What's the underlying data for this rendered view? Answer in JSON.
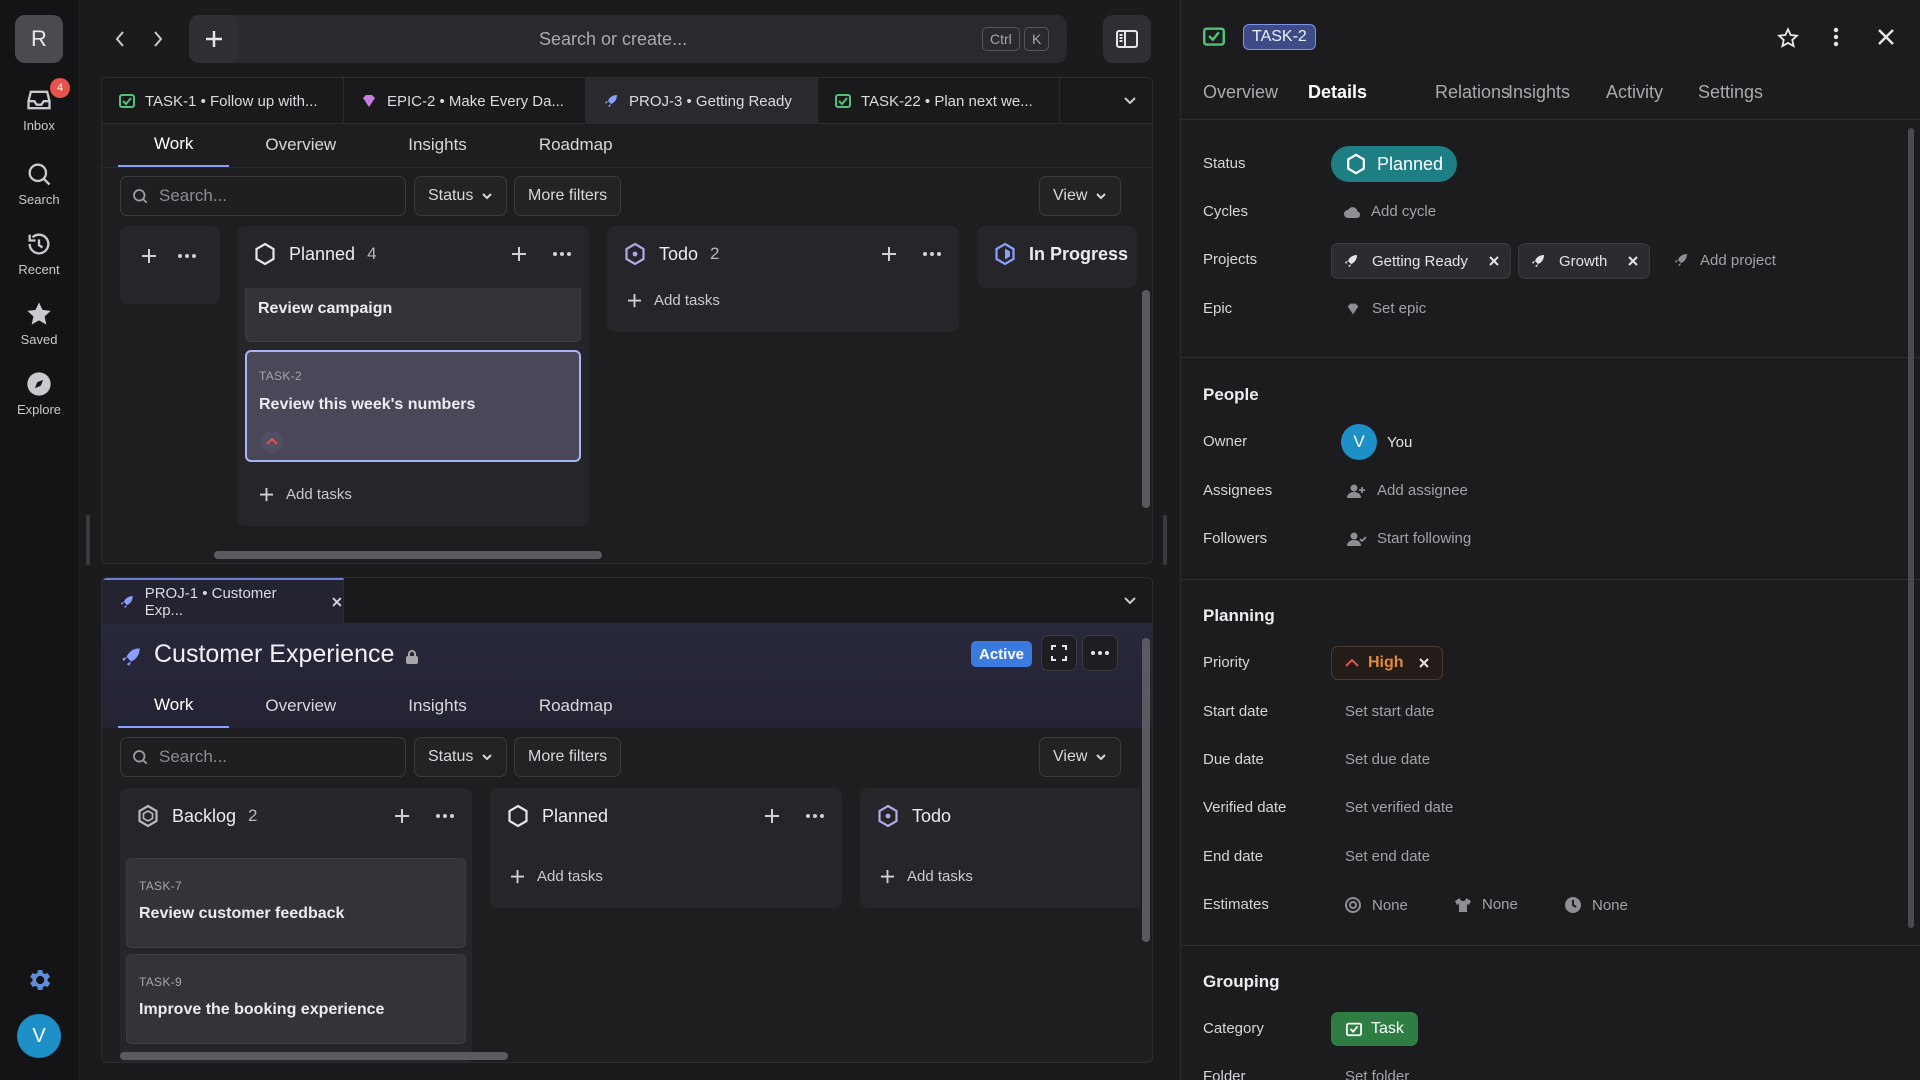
{
  "sidebar": {
    "workspace_initial": "R",
    "items": [
      {
        "label": "Inbox",
        "badge": "4"
      },
      {
        "label": "Search"
      },
      {
        "label": "Recent"
      },
      {
        "label": "Saved"
      },
      {
        "label": "Explore"
      }
    ],
    "user_initial": "V"
  },
  "topbar": {
    "search_placeholder": "Search or create...",
    "shortcut_keys": [
      "Ctrl",
      "K"
    ]
  },
  "upper_pane": {
    "tabs": [
      {
        "label": "TASK-1 • Follow up with...",
        "icon": "task-icon"
      },
      {
        "label": "EPIC-2 • Make Every Da...",
        "icon": "epic-icon"
      },
      {
        "label": "PROJ-3 • Getting Ready",
        "icon": "project-icon"
      },
      {
        "label": "TASK-22 • Plan next we...",
        "icon": "task-icon"
      }
    ],
    "subtabs": [
      "Work",
      "Overview",
      "Insights",
      "Roadmap"
    ],
    "filters": {
      "search_placeholder": "Search...",
      "status": "Status",
      "more": "More filters",
      "view": "View"
    },
    "columns": [
      {
        "title": "Planned",
        "count": "4",
        "cards": [
          {
            "title": "Review campaign"
          },
          {
            "id": "TASK-2",
            "title": "Review this week's numbers"
          }
        ],
        "add": "Add tasks"
      },
      {
        "title": "Todo",
        "count": "2",
        "add": "Add tasks"
      },
      {
        "title": "In Progress"
      }
    ]
  },
  "lower_pane": {
    "tab": "PROJ-1 • Customer Exp...",
    "project_title": "Customer Experience",
    "status_badge": "Active",
    "subtabs": [
      "Work",
      "Overview",
      "Insights",
      "Roadmap"
    ],
    "filters": {
      "search_placeholder": "Search...",
      "status": "Status",
      "more": "More filters",
      "view": "View"
    },
    "columns": [
      {
        "title": "Backlog",
        "count": "2",
        "cards": [
          {
            "id": "TASK-7",
            "title": "Review customer feedback"
          },
          {
            "id": "TASK-9",
            "title": "Improve the booking experience"
          }
        ]
      },
      {
        "title": "Planned",
        "add": "Add tasks"
      },
      {
        "title": "Todo",
        "add": "Add tasks"
      }
    ]
  },
  "detail": {
    "task_id": "TASK-2",
    "tabs": [
      "Overview",
      "Details",
      "Relations",
      "Insights",
      "Activity",
      "Settings"
    ],
    "status_label": "Status",
    "status_value": "Planned",
    "cycles_label": "Cycles",
    "cycles_value": "Add cycle",
    "projects_label": "Projects",
    "projects": [
      "Getting Ready",
      "Growth"
    ],
    "add_project": "Add project",
    "epic_label": "Epic",
    "epic_value": "Set epic",
    "people_title": "People",
    "owner_label": "Owner",
    "owner_initial": "V",
    "owner_value": "You",
    "assignees_label": "Assignees",
    "assignees_value": "Add assignee",
    "followers_label": "Followers",
    "followers_value": "Start following",
    "planning_title": "Planning",
    "priority_label": "Priority",
    "priority_value": "High",
    "start_label": "Start date",
    "start_value": "Set start date",
    "due_label": "Due date",
    "due_value": "Set due date",
    "verified_label": "Verified date",
    "verified_value": "Set verified date",
    "end_label": "End date",
    "end_value": "Set end date",
    "estimates_label": "Estimates",
    "estimates": [
      "None",
      "None",
      "None"
    ],
    "grouping_title": "Grouping",
    "category_label": "Category",
    "category_value": "Task",
    "folder_label": "Folder",
    "folder_value": "Set folder"
  },
  "colors": {
    "accent": "#8aa0ff",
    "status_planned": "#1d7f83",
    "category_task": "#2e7d43",
    "priority_high": "#e08a3a",
    "badge_active": "#3b7be0"
  }
}
